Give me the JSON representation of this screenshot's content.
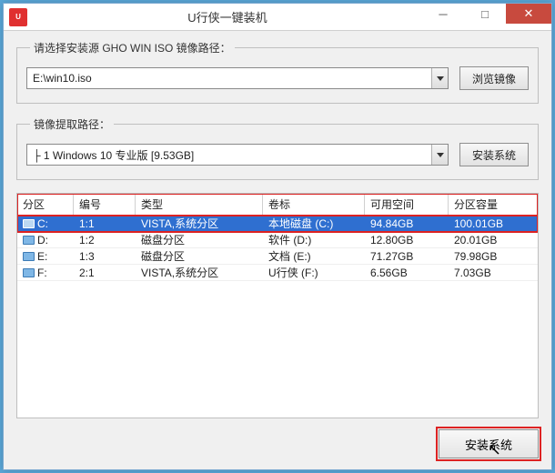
{
  "window": {
    "title": "U行侠一键装机",
    "app_icon_text": "U"
  },
  "source_group": {
    "legend": "请选择安装源 GHO WIN ISO 镜像路径：",
    "value": "E:\\win10.iso",
    "browse_label": "浏览镜像"
  },
  "extract_group": {
    "legend": "镜像提取路径：",
    "value": "├ 1 Windows 10 专业版 [9.53GB]",
    "install_label": "安装系统"
  },
  "table": {
    "columns": [
      "分区",
      "编号",
      "类型",
      "卷标",
      "可用空间",
      "分区容量"
    ],
    "rows": [
      {
        "drive": "C:",
        "num": "1:1",
        "type": "VISTA,系统分区",
        "label": "本地磁盘 (C:)",
        "free": "94.84GB",
        "size": "100.01GB",
        "selected": true
      },
      {
        "drive": "D:",
        "num": "1:2",
        "type": "磁盘分区",
        "label": "软件 (D:)",
        "free": "12.80GB",
        "size": "20.01GB",
        "selected": false
      },
      {
        "drive": "E:",
        "num": "1:3",
        "type": "磁盘分区",
        "label": "文档 (E:)",
        "free": "71.27GB",
        "size": "79.98GB",
        "selected": false
      },
      {
        "drive": "F:",
        "num": "2:1",
        "type": "VISTA,系统分区",
        "label": "U行侠 (F:)",
        "free": "6.56GB",
        "size": "7.03GB",
        "selected": false
      }
    ]
  },
  "footer": {
    "install_label": "安装系统"
  }
}
